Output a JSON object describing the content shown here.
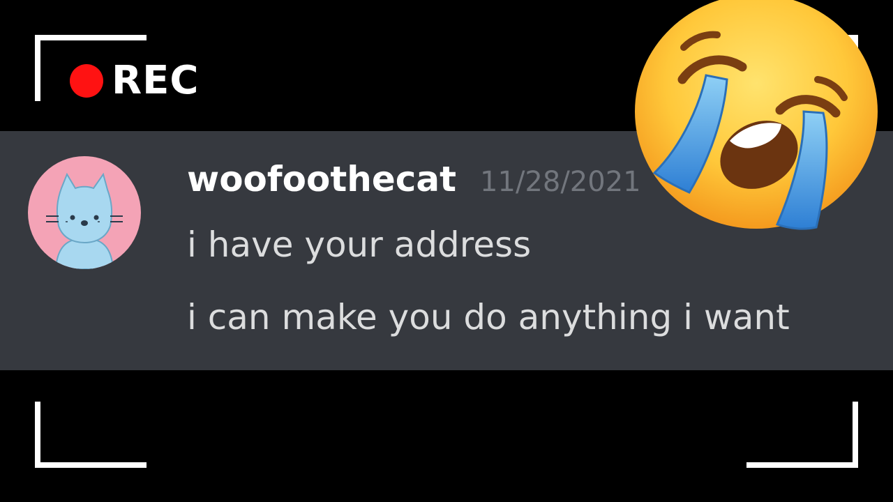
{
  "recording": {
    "label": "REC",
    "indicator_color": "#ff1212"
  },
  "message": {
    "username": "woofoothecat",
    "timestamp": "11/28/2021",
    "lines": [
      "i have your address",
      "i can make you do anything i want"
    ],
    "avatar_icon": "cat-avatar-icon"
  },
  "overlay": {
    "emoji_icon": "loudly-crying-face-icon"
  },
  "colors": {
    "background": "#000000",
    "message_band": "#36393f",
    "username": "#ffffff",
    "timestamp": "#72767d",
    "message_text": "#dcddde",
    "avatar_bg": "#f4a3b6",
    "avatar_cat": "#a8d8f0"
  }
}
